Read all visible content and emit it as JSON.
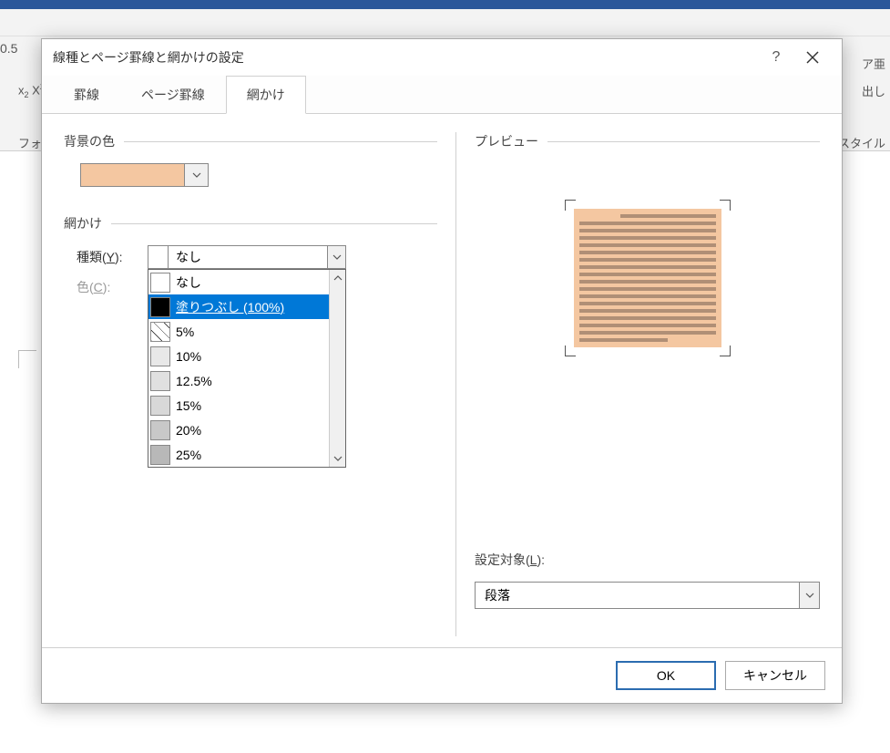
{
  "dialog": {
    "title": "線種とページ罫線と網かけの設定",
    "help": "?",
    "tabs": {
      "borders": "罫線",
      "page_borders": "ページ罫線",
      "shading": "網かけ"
    },
    "bg_color_label": "背景の色",
    "shading_label": "網かけ",
    "type_label_pre": "種類(",
    "type_accel": "Y",
    "type_label_post": "):",
    "color_label_pre": "色(",
    "color_accel": "C",
    "color_label_post": "):",
    "type_value": "なし",
    "type_options": [
      "なし",
      "塗りつぶし (100%)",
      "5%",
      "10%",
      "12.5%",
      "15%",
      "20%",
      "25%"
    ],
    "preview_label": "プレビュー",
    "apply_label_pre": "設定対象(",
    "apply_accel": "L",
    "apply_label_post": "):",
    "apply_value": "段落",
    "ok": "OK",
    "cancel": "キャンセル"
  },
  "bg": {
    "font_group": "フォ",
    "size": "0.5",
    "clear": "ア亜",
    "heading": "出し",
    "style": "スタイル"
  },
  "colors": {
    "fill": "#f4c7a1",
    "highlight": "#0078d7"
  }
}
